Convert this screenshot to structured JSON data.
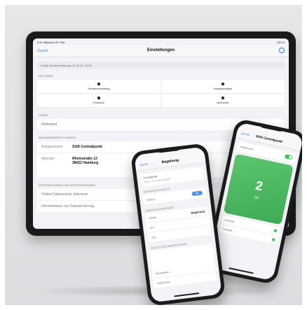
{
  "ipad": {
    "status_left": "9:41  Mittwoch 23. Feb.",
    "status_right": "100 %",
    "nav_back": "Zurück",
    "title": "Einstellungen",
    "info_row": "Letzte Synchronisierung: 21.02.22, 11:38",
    "sections": {
      "actions": "AKTIONEN",
      "device": "GERÄT",
      "unit": "ANLAGENEINSTELLUNGEN",
      "privacy": "INFORMATIONEN ZUR DATENSICHERUNG"
    },
    "actions": [
      "Geräteverwaltung",
      "Vorlagenregeln",
      "Protokoll",
      "Übersicht"
    ],
    "device_value": "Dortmund",
    "unit_name_label": "Anlagenname",
    "unit_name_value": "SGB Centralpunkt",
    "address_label": "Adresse",
    "address_line1": "Rheinstraße 12",
    "address_line2": "38422 Hamburg",
    "privacy_row1": "Online-Datenschutz aktivieren",
    "privacy_row2": "Informationen zur Datensicherung"
  },
  "phone1": {
    "nav_back": "Zurück",
    "title": "Begehung",
    "card_line1": "Centralpunkt",
    "card_line2": "Seit 27.02.2022 Geprüft",
    "sec1": "SICHERHEITSPUNKTE",
    "row1_label": "Status",
    "row1_pill": "OK",
    "sec2": "BEGEHUNGSANGABEN",
    "row2_label": "Name",
    "row2_value": "Begehung",
    "row3_label": "Ort",
    "row4_label": "Typ",
    "sec3": "ZUSÄTZLICHE BEMERKUNGEN",
    "footer1": "Bearbeiten",
    "footer2": "Abbrechen"
  },
  "phone2": {
    "nav_back": "Zurück",
    "title": "SGB Centralpunkt",
    "toggle_label": "Anlage aktiv",
    "big_number": "2",
    "status": "OK",
    "list1": "Kontrolle",
    "list2": "Freigabe"
  }
}
